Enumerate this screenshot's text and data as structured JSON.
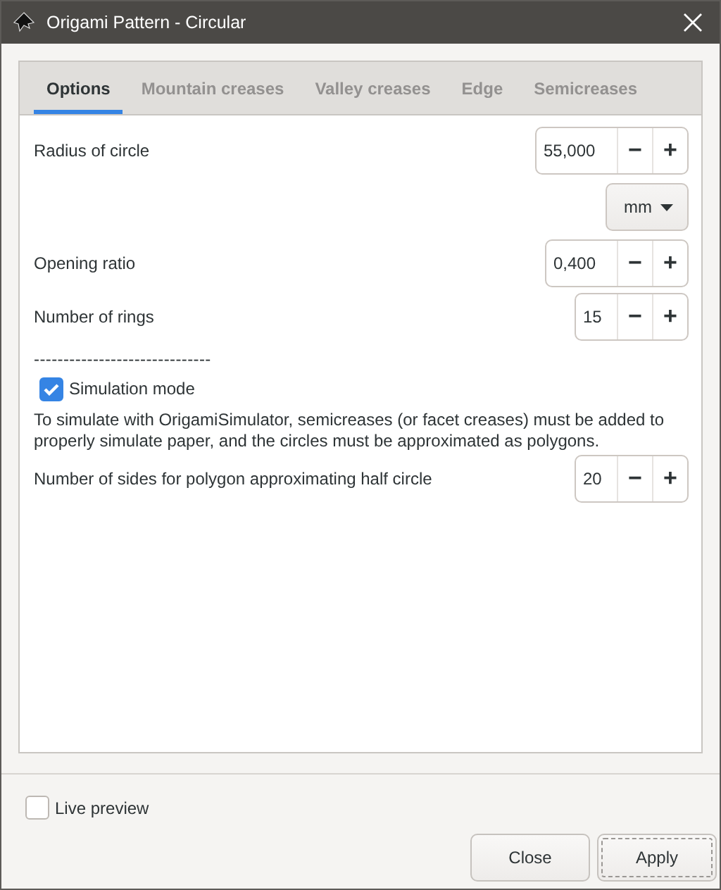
{
  "window": {
    "title": "Origami Pattern - Circular"
  },
  "tabs": [
    {
      "label": "Options",
      "selected": true
    },
    {
      "label": "Mountain creases",
      "selected": false
    },
    {
      "label": "Valley creases",
      "selected": false
    },
    {
      "label": "Edge",
      "selected": false
    },
    {
      "label": "Semicreases",
      "selected": false
    }
  ],
  "rows": [
    {
      "kind": "spin",
      "label": "Radius of circle",
      "value": "55,000",
      "minus": "−",
      "plus": "+"
    },
    {
      "kind": "unit",
      "value": "mm"
    },
    {
      "kind": "spin",
      "label": "Opening ratio",
      "value": "0,400",
      "minus": "−",
      "plus": "+"
    },
    {
      "kind": "spin",
      "label": "Number of rings",
      "value": "15",
      "minus": "−",
      "plus": "+"
    },
    {
      "kind": "separator",
      "text": "------------------------------"
    },
    {
      "kind": "checkbox",
      "label": "Simulation mode",
      "checked": true
    },
    {
      "kind": "paragraph",
      "text": "To simulate with OrigamiSimulator, semicreases (or facet creases) must be added to properly simulate paper, and the circles must be approximated as polygons."
    },
    {
      "kind": "spin",
      "label": "Number of sides for polygon approximating half circle",
      "value": "20",
      "minus": "−",
      "plus": "+"
    }
  ],
  "live_preview": {
    "label": "Live preview",
    "checked": false
  },
  "buttons": [
    {
      "label": "Close",
      "focused": false
    },
    {
      "label": "Apply",
      "focused": true
    }
  ]
}
